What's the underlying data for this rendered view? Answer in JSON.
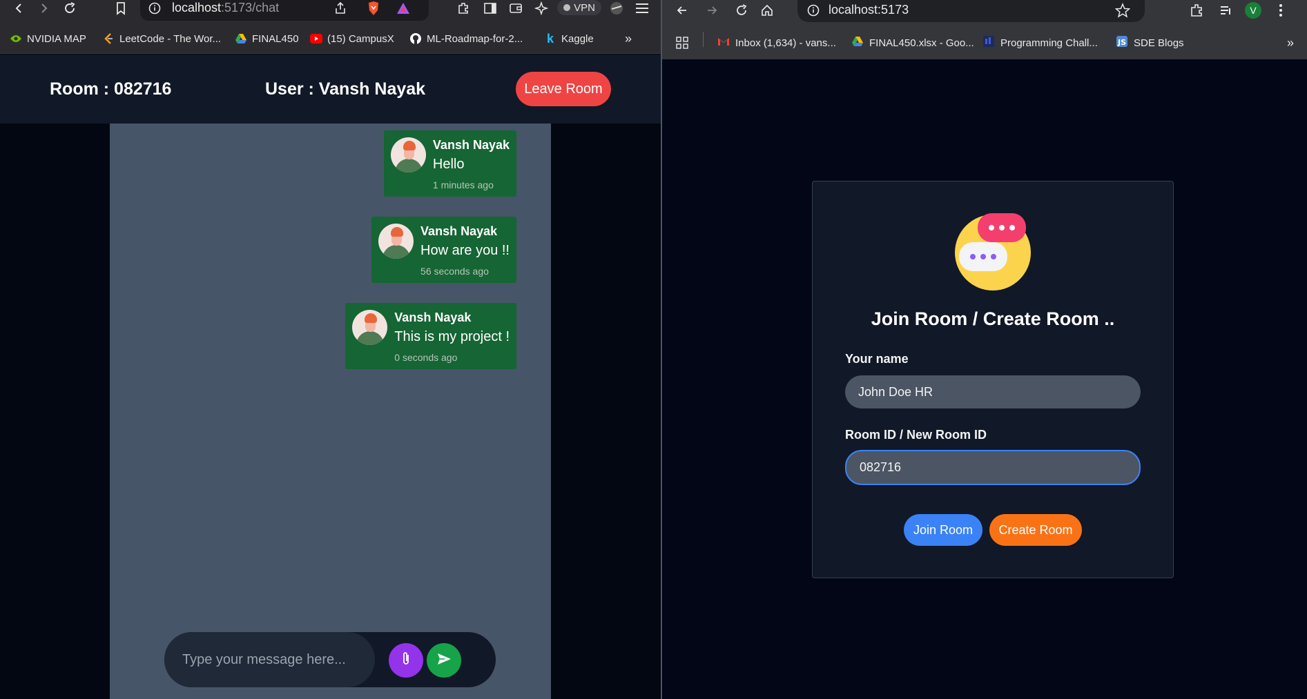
{
  "left_browser": {
    "url_host": "localhost",
    "url_rest": ":5173/chat",
    "vpn_label": "VPN",
    "bookmarks": [
      {
        "label": "NVIDIA MAP",
        "icon": "nvidia-icon",
        "color": "#76b900"
      },
      {
        "label": "LeetCode - The Wor...",
        "icon": "leetcode-icon",
        "color": "#f89f1b"
      },
      {
        "label": "FINAL450",
        "icon": "drive-icon",
        "color": "#34a853"
      },
      {
        "label": "(15) CampusX",
        "icon": "youtube-icon",
        "color": "#ff0000"
      },
      {
        "label": "ML-Roadmap-for-2...",
        "icon": "github-icon",
        "color": "#ffffff"
      },
      {
        "label": "Kaggle",
        "icon": "kaggle-icon",
        "color": "#20beff"
      }
    ]
  },
  "chat": {
    "room_label": "Room : 082716",
    "user_label": "User : Vansh Nayak",
    "leave_label": "Leave Room",
    "messages": [
      {
        "sender": "Vansh Nayak",
        "text": "Hello",
        "time": "1 minutes ago"
      },
      {
        "sender": "Vansh Nayak",
        "text": "How are you !!",
        "time": "56 seconds ago"
      },
      {
        "sender": "Vansh Nayak",
        "text": "This is my project !",
        "time": "0 seconds ago"
      }
    ],
    "input_placeholder": "Type your message here..."
  },
  "right_browser": {
    "url": "localhost:5173",
    "profile_initial": "V",
    "bookmarks": [
      {
        "label": "Inbox (1,634) - vans...",
        "icon": "gmail-icon"
      },
      {
        "label": "FINAL450.xlsx - Goo...",
        "icon": "drive-icon"
      },
      {
        "label": "Programming Chall...",
        "icon": "programming-icon"
      },
      {
        "label": "SDE Blogs",
        "icon": "blog-icon"
      }
    ]
  },
  "join_form": {
    "title": "Join Room / Create Room ..",
    "name_label": "Your name",
    "name_value": "John Doe HR",
    "room_label": "Room ID / New Room ID",
    "room_value": "082716",
    "join_label": "Join Room",
    "create_label": "Create Room"
  },
  "colors": {
    "leave": "#ef4444",
    "bubble": "#166534",
    "attach": "#9333ea",
    "send": "#16a34a",
    "join": "#3b82f6",
    "create": "#f97316"
  }
}
